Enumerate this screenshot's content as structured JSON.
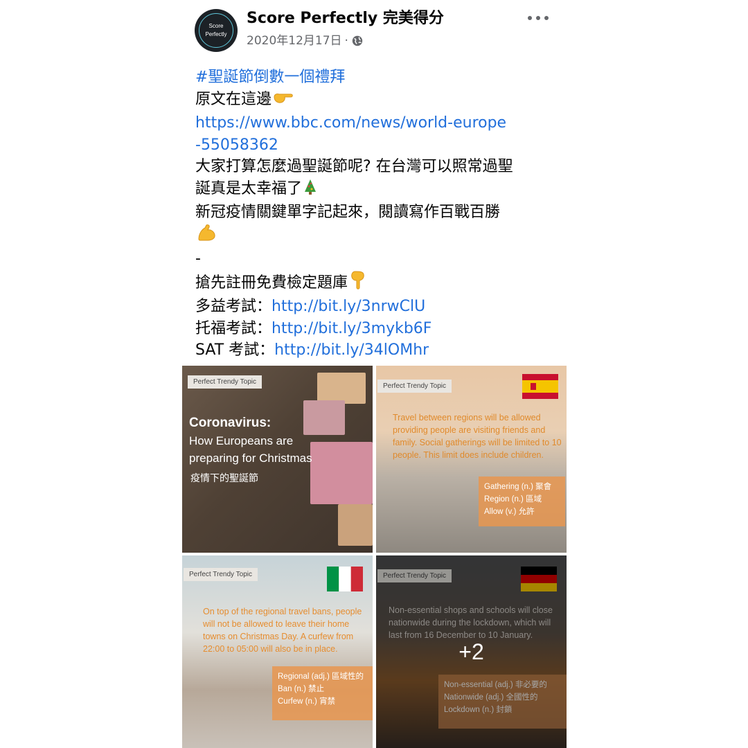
{
  "header": {
    "avatar_text": [
      "Score",
      "Perfectly"
    ],
    "page_name": "Score Perfectly 完美得分",
    "date": "2020年12月17日",
    "separator": "·"
  },
  "post": {
    "hashtag": "#聖誕節倒數一個禮拜",
    "line_source": "原文在這邊",
    "source_link_1": "https://www.bbc.com/news/world-europe",
    "source_link_2": "-55058362",
    "line_plan_1": "大家打算怎麼過聖誕節呢? 在台灣可以照常過聖",
    "line_plan_2": "誕真是太幸福了",
    "line_keywords": "新冠疫情關鍵單字記起來，閱讀寫作百戰百勝",
    "dash": "-",
    "line_register": "搶先註冊免費檢定題庫",
    "links": [
      {
        "label": "多益考試：",
        "url": "http://bit.ly/3nrwClU"
      },
      {
        "label": "托福考試：",
        "url": "http://bit.ly/3mykb6F"
      },
      {
        "label": "SAT 考試：",
        "url": "http://bit.ly/34lOMhr"
      }
    ]
  },
  "images": {
    "tag": "Perfect Trendy Topic",
    "tile1": {
      "title": "Coronavirus:",
      "subtitle": "How Europeans are preparing for Christmas",
      "chinese": "疫情下的聖誕節"
    },
    "tile2": {
      "paragraph": "Travel between regions will be allowed providing people are visiting friends and family. Social gatherings will be limited to 10 people. This limit does include children.",
      "vocab": [
        "Gathering (n.) 聚會",
        "Region (n.) 區域",
        "Allow (v.) 允許"
      ]
    },
    "tile3": {
      "paragraph": "On top of the regional travel bans, people will not be allowed to leave their home towns on Christmas Day.  A curfew from 22:00 to 05:00 will also be in place.",
      "vocab": [
        "Regional (adj.) 區域性的",
        "Ban (n.) 禁止",
        "Curfew (n.) 宵禁"
      ]
    },
    "tile4": {
      "paragraph": "Non-essential shops and schools will close nationwide during the lockdown, which will last from 16 December to 10 January.",
      "vocab": [
        "Non-essential (adj.) 非必要的",
        "Nationwide (adj.) 全國性的",
        "Lockdown (n.) 封鎖"
      ],
      "more_count": "+2"
    }
  }
}
